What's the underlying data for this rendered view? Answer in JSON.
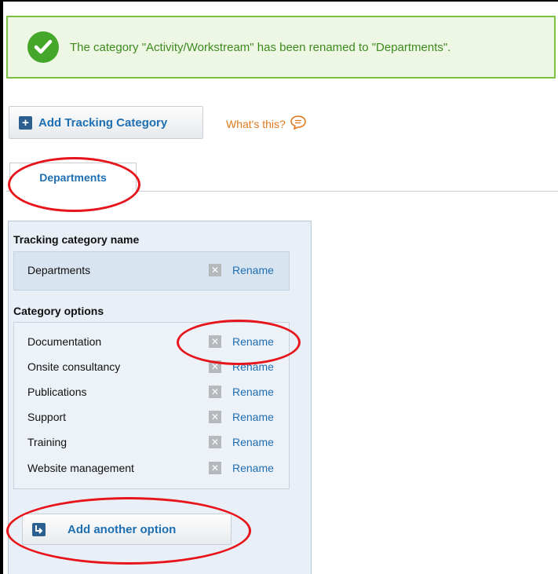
{
  "banner": {
    "message": "The category \"Activity/Workstream\" has been renamed to \"Departments\".",
    "icon": "check-circle-icon",
    "color": "#44a729"
  },
  "toolbar": {
    "add_category_label": "Add Tracking Category",
    "whats_this_label": "What's this?"
  },
  "tabs": [
    {
      "label": "Departments"
    }
  ],
  "panel": {
    "name_heading": "Tracking category name",
    "name_value": "Departments",
    "options_heading": "Category options",
    "rename_label": "Rename",
    "options": [
      {
        "label": "Documentation"
      },
      {
        "label": "Onsite consultancy"
      },
      {
        "label": "Publications"
      },
      {
        "label": "Support"
      },
      {
        "label": "Training"
      },
      {
        "label": "Website management"
      }
    ],
    "add_option_label": "Add another option"
  },
  "colors": {
    "link_blue": "#1e6fb3",
    "annotation_red": "#e8141b",
    "whats_this_orange": "#e0791e"
  }
}
